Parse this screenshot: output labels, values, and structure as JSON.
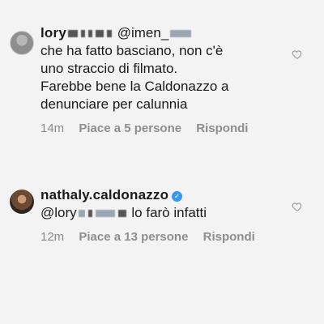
{
  "comments": [
    {
      "username": "lory",
      "mention": "@imen_",
      "lines": [
        "che ha fatto basciano, non c'è",
        "uno straccio di filmato.",
        "Farebbe bene la Caldonazzo a",
        "denunciare per calunnia"
      ],
      "time": "14m",
      "likes": "Piace a 5 persone",
      "reply": "Rispondi"
    },
    {
      "username": "nathaly.caldonazzo",
      "verified_mark": "✓",
      "mention": "@lory",
      "reply_text": "lo farò infatti",
      "time": "12m",
      "likes": "Piace a 13 persone",
      "reply": "Rispondi"
    }
  ],
  "icons": {
    "like": "heart-icon",
    "verified": "verified-badge-icon"
  },
  "colors": {
    "background": "#f3f3f3",
    "meta_text": "#8a8a8a",
    "verified": "#3897f0"
  }
}
